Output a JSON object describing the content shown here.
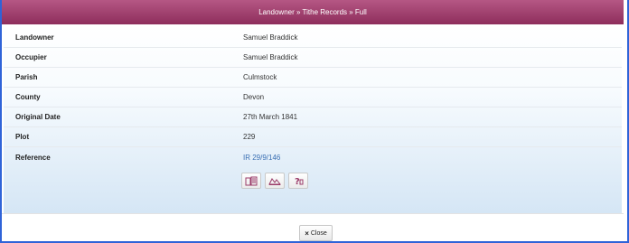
{
  "header": {
    "title": "Landowner » Tithe Records » Full"
  },
  "rows": [
    {
      "label": "Landowner",
      "value": "Samuel Braddick"
    },
    {
      "label": "Occupier",
      "value": "Samuel Braddick"
    },
    {
      "label": "Parish",
      "value": "Culmstock"
    },
    {
      "label": "County",
      "value": "Devon"
    },
    {
      "label": "Original Date",
      "value": "27th March 1841"
    },
    {
      "label": "Plot",
      "value": "229"
    },
    {
      "label": "Reference",
      "value": "IR 29/9/146"
    }
  ],
  "icons": [
    "records-icon",
    "map-icon",
    "help-icon"
  ],
  "footer": {
    "close_label": "Close",
    "close_icon": "×"
  },
  "colors": {
    "header": "#9a3a68",
    "link": "#3a6fb3",
    "frame": "#2f63d8"
  }
}
